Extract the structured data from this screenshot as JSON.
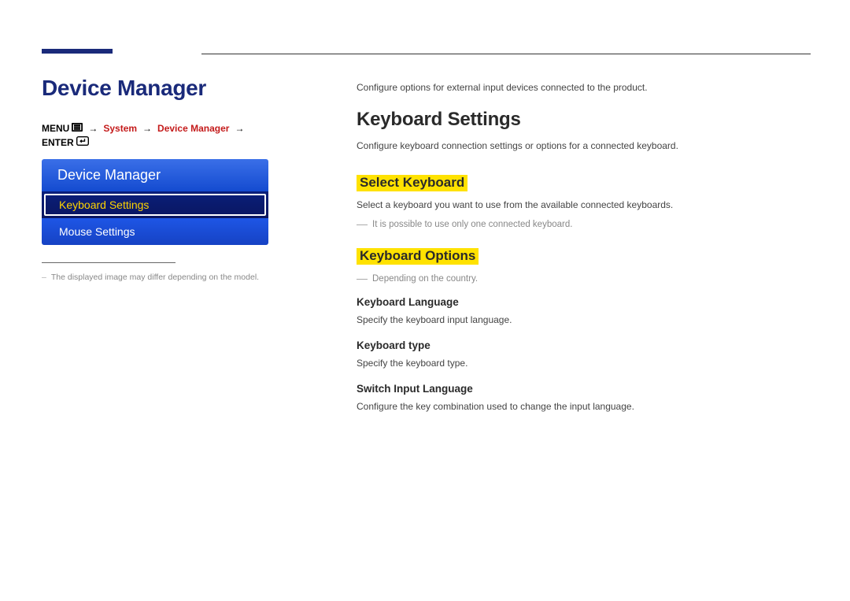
{
  "page_title": "Device Manager",
  "breadcrumb": {
    "menu_label": "MENU",
    "path_system": "System",
    "path_device_manager": "Device Manager",
    "enter_label": "ENTER",
    "arrow": "→"
  },
  "osd": {
    "title": "Device Manager",
    "items": [
      {
        "label": "Keyboard Settings",
        "selected": true
      },
      {
        "label": "Mouse Settings",
        "selected": false
      }
    ]
  },
  "left_footnote": "The displayed image may differ depending on the model.",
  "content": {
    "intro": "Configure options for external input devices connected to the product.",
    "h2": "Keyboard Settings",
    "h2_desc": "Configure keyboard connection settings or options for a connected keyboard.",
    "select_keyboard": {
      "heading": "Select Keyboard",
      "desc": "Select a keyboard you want to use from the available connected keyboards.",
      "note": "It is possible to use only one connected keyboard."
    },
    "keyboard_options": {
      "heading": "Keyboard Options",
      "note": "Depending on the country.",
      "items": [
        {
          "title": "Keyboard Language",
          "desc": "Specify the keyboard input language."
        },
        {
          "title": "Keyboard type",
          "desc": "Specify the keyboard type."
        },
        {
          "title": "Switch Input Language",
          "desc": "Configure the key combination used to change the input language."
        }
      ]
    }
  }
}
